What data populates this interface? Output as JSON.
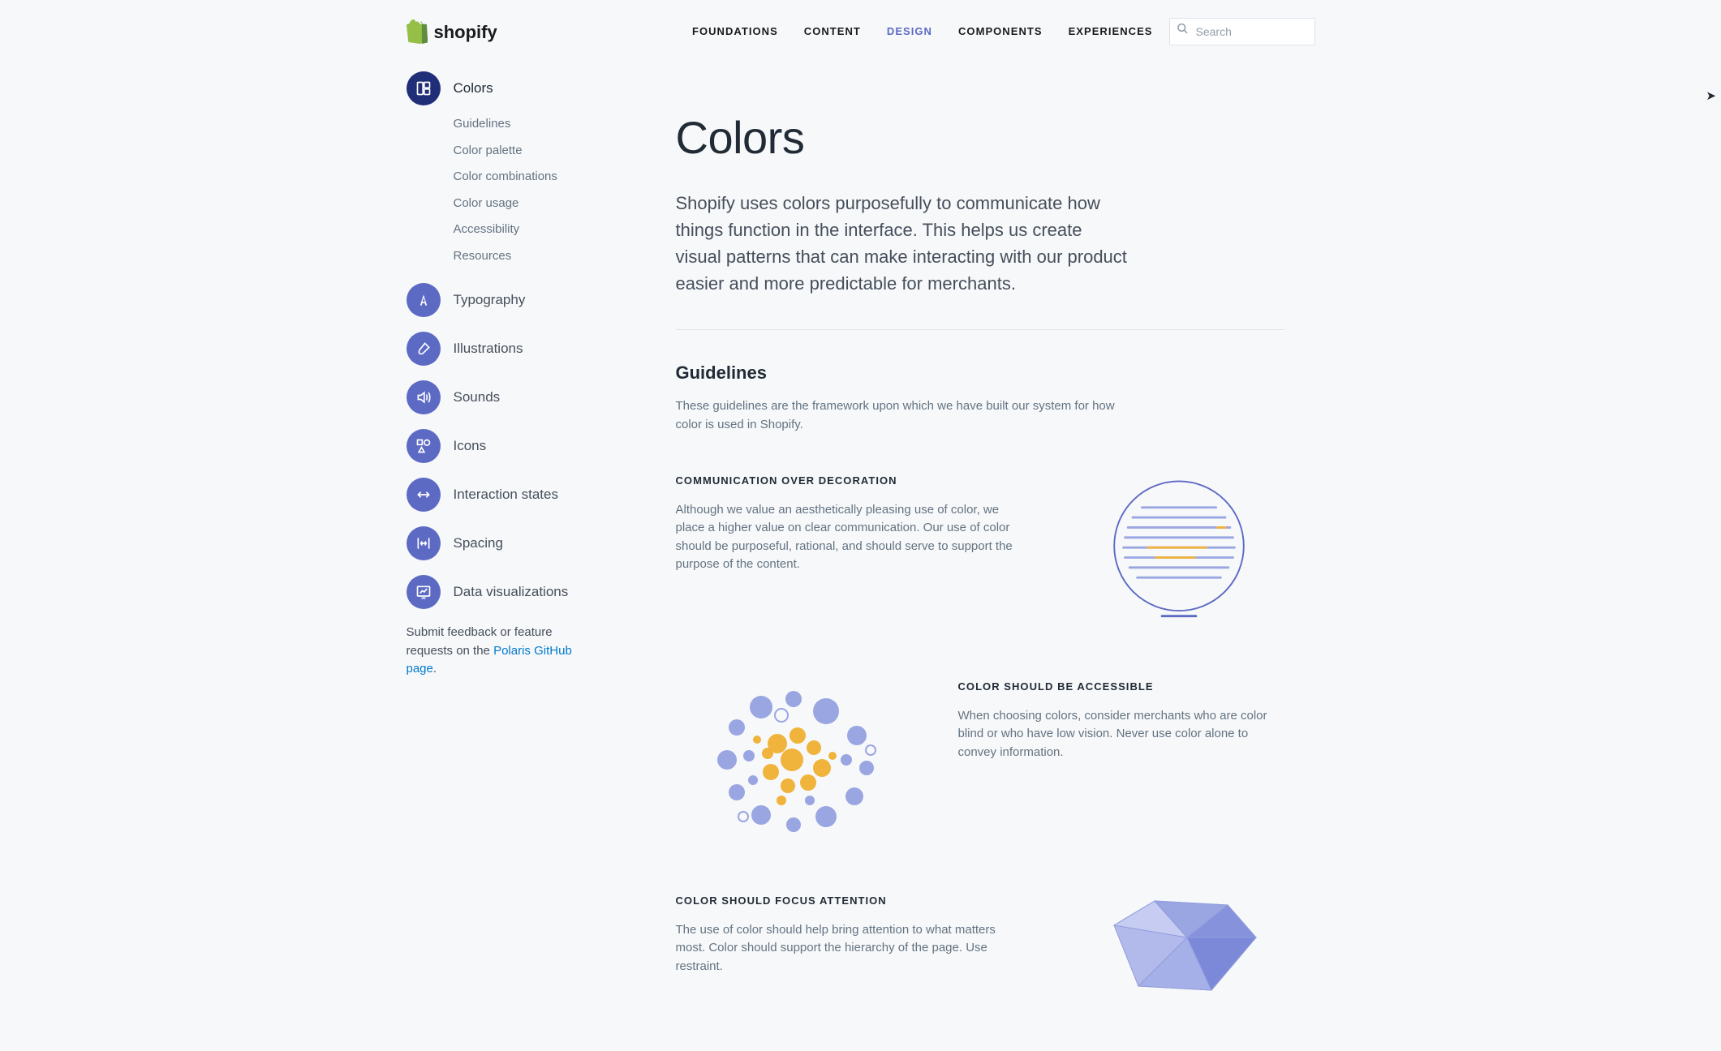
{
  "brand": {
    "name": "shopify"
  },
  "nav": {
    "items": [
      {
        "label": "FOUNDATIONS"
      },
      {
        "label": "CONTENT"
      },
      {
        "label": "DESIGN"
      },
      {
        "label": "COMPONENTS"
      },
      {
        "label": "EXPERIENCES"
      }
    ],
    "active_index": 2
  },
  "search": {
    "placeholder": "Search"
  },
  "sidebar": {
    "items": [
      {
        "label": "Colors",
        "active": true,
        "sub": [
          "Guidelines",
          "Color palette",
          "Color combinations",
          "Color usage",
          "Accessibility",
          "Resources"
        ]
      },
      {
        "label": "Typography"
      },
      {
        "label": "Illustrations"
      },
      {
        "label": "Sounds"
      },
      {
        "label": "Icons"
      },
      {
        "label": "Interaction states"
      },
      {
        "label": "Spacing"
      },
      {
        "label": "Data visualizations"
      }
    ]
  },
  "feedback": {
    "prefix": "Submit feedback or feature requests on the ",
    "link_text": "Polaris GitHub page",
    "suffix": "."
  },
  "page": {
    "title": "Colors",
    "lead": "Shopify uses colors purposefully to communicate how things function in the interface. This helps us create visual patterns that can make interacting with our product easier and more predictable for merchants.",
    "section_title": "Guidelines",
    "section_sub": "These guidelines are the framework upon which we have built our system for how color is used in Shopify.",
    "blocks": [
      {
        "kicker": "COMMUNICATION OVER DECORATION",
        "body": "Although we value an aesthetically pleasing use of color, we place a higher value on clear communication. Our use of color should be purposeful, rational, and should serve to support the purpose of the content."
      },
      {
        "kicker": "COLOR SHOULD BE ACCESSIBLE",
        "body": "When choosing colors, consider merchants who are color blind or who have low vision. Never use color alone to convey information."
      },
      {
        "kicker": "COLOR SHOULD FOCUS ATTENTION",
        "body": "The use of color should help bring attention to what matters most. Color should support the hierarchy of the page. Use restraint."
      }
    ]
  }
}
